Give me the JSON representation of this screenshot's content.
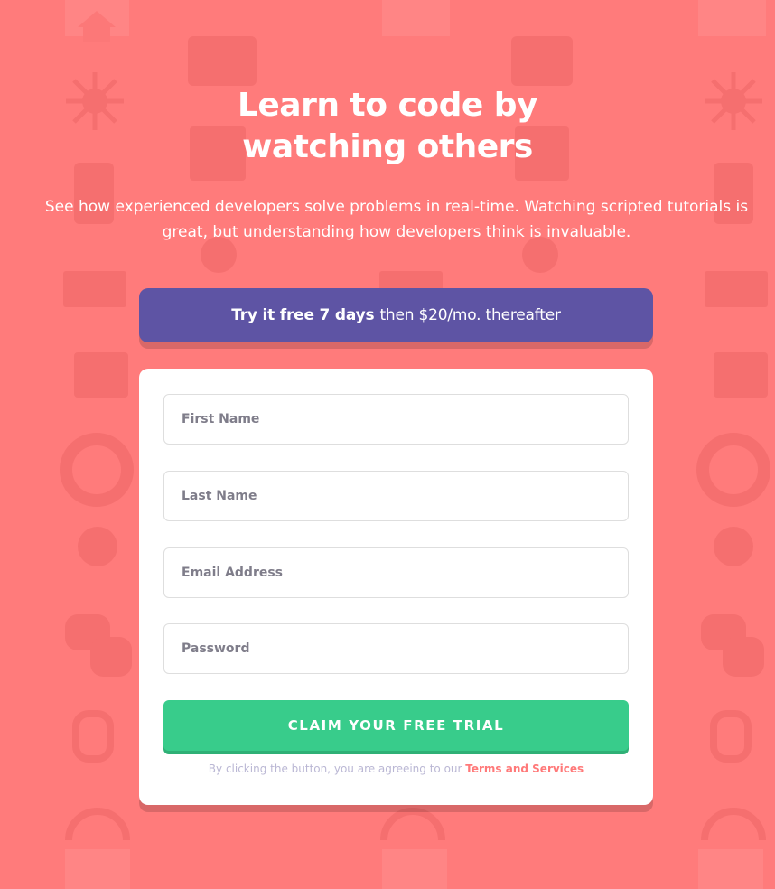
{
  "colors": {
    "background": "#ff7b7b",
    "promo": "#5e54a4",
    "button": "#38cc8b",
    "link": "#ff7979"
  },
  "hero": {
    "title_line1": "Learn to code by",
    "title_line2": "watching others",
    "description": "See how experienced developers solve problems in real-time. Watching scripted tutorials is great, but understanding how developers think is invaluable."
  },
  "promo": {
    "bold": "Try it free 7 days",
    "rest": "then $20/mo. thereafter"
  },
  "form": {
    "fields": [
      {
        "placeholder": "First Name",
        "value": ""
      },
      {
        "placeholder": "Last Name",
        "value": ""
      },
      {
        "placeholder": "Email Address",
        "value": ""
      },
      {
        "placeholder": "Password",
        "value": ""
      }
    ],
    "submit_label": "CLAIM YOUR FREE TRIAL",
    "terms_text": "By clicking the button, you are agreeing to our",
    "terms_link": "Terms and Services"
  },
  "background_icons": [
    "house-icon",
    "toolbox-icon",
    "network-icon",
    "document-icon",
    "phone-icon",
    "gear-icon",
    "edit-icon",
    "cart-icon",
    "lifebuoy-icon",
    "lightbulb-icon",
    "chat-icon",
    "link-icon",
    "headphones-icon"
  ]
}
